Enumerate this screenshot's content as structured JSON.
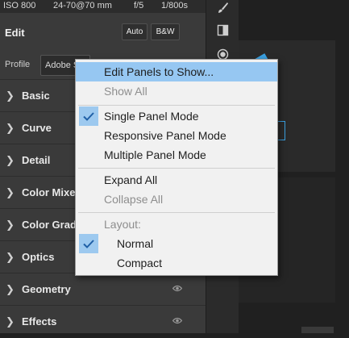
{
  "meta_bar": {
    "iso": "ISO 800",
    "lens": "24-70@70 mm",
    "aperture": "f/5",
    "shutter": "1/800s"
  },
  "edit": {
    "title": "Edit",
    "auto_label": "Auto",
    "bw_label": "B&W"
  },
  "profile": {
    "label": "Profile",
    "value": "Adobe S"
  },
  "sections": [
    {
      "label": "Basic"
    },
    {
      "label": "Curve"
    },
    {
      "label": "Detail"
    },
    {
      "label": "Color Mixe"
    },
    {
      "label": "Color Grad"
    },
    {
      "label": "Optics"
    },
    {
      "label": "Geometry"
    },
    {
      "label": "Effects"
    }
  ],
  "tools": [
    "brush-icon",
    "crop-square-icon",
    "circle-icon"
  ],
  "context_menu": {
    "items": [
      {
        "label": "Edit Panels to Show...",
        "state": "highlighted"
      },
      {
        "label": "Show All",
        "state": "disabled"
      },
      {
        "label": "Single Panel Mode",
        "state": "checked"
      },
      {
        "label": "Responsive Panel Mode",
        "state": "normal"
      },
      {
        "label": "Multiple Panel Mode",
        "state": "normal"
      },
      {
        "label": "Expand All",
        "state": "normal"
      },
      {
        "label": "Collapse All",
        "state": "disabled"
      },
      {
        "label": "Layout:",
        "state": "disabled"
      },
      {
        "label": "Normal",
        "state": "checked"
      },
      {
        "label": "Compact",
        "state": "normal"
      }
    ],
    "highlight_color": "#96c7f2",
    "check_color": "#2a6db0"
  },
  "colors": {
    "panel_bg": "#3a3a3a",
    "accent": "#3aa0e0"
  }
}
